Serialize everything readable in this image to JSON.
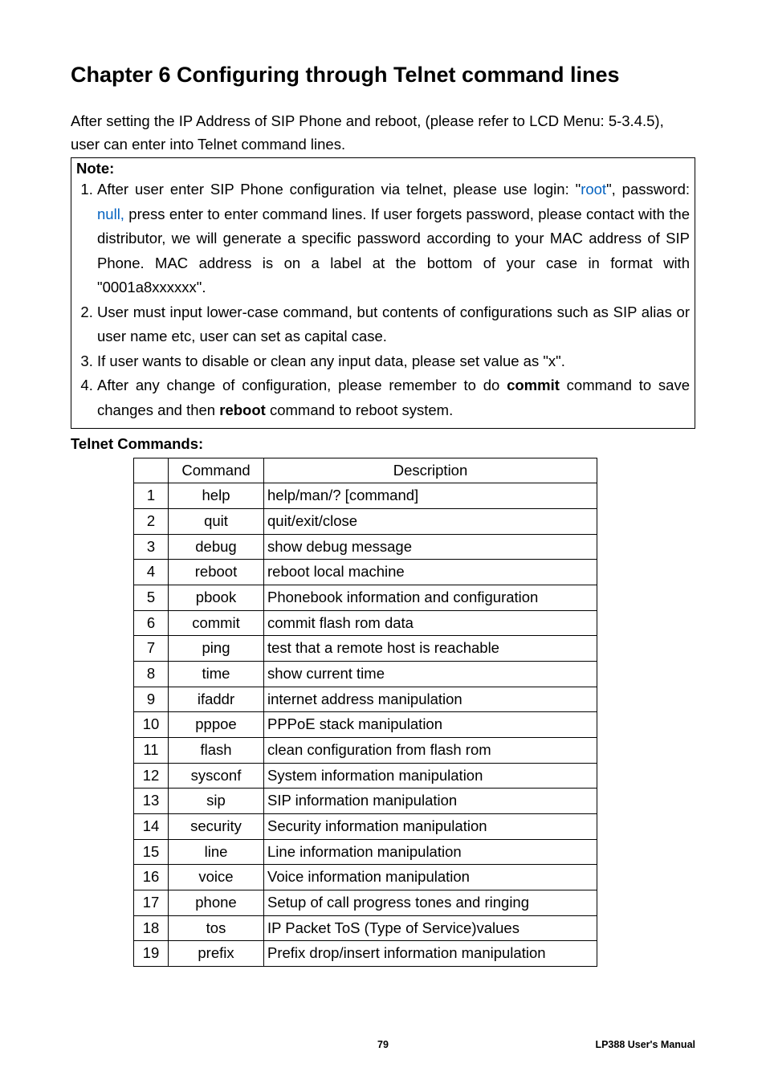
{
  "chapterTitle": "Chapter 6 Configuring through Telnet command lines",
  "intro": "After setting the IP Address of SIP Phone and reboot, (please refer to LCD Menu: 5-3.4.5), user can enter into Telnet command lines.",
  "noteLabel": "Note:",
  "notes": {
    "n1a": "After user enter SIP Phone configuration via telnet, please use login: \"",
    "n1root": "root",
    "n1b": "\", password: ",
    "n1null": "null,",
    "n1c": " press enter to enter command lines. If user forgets password, please contact with the distributor, we will generate a specific password according to your MAC address of SIP Phone. MAC address is on a label at the bottom of your case in format with \"0001a8xxxxxx\".",
    "n2": "User must input lower-case command, but contents of configurations such as SIP alias or user name etc, user can set as capital case.",
    "n3": "If user wants to disable or clean any input data, please set value as \"x\".",
    "n4a": "After any change of configuration, please remember to do ",
    "n4commit": "commit",
    "n4b": " command to save changes and then ",
    "n4reboot": "reboot",
    "n4c": " command to reboot system."
  },
  "telnetHeading": "Telnet Commands:",
  "tableHeaders": {
    "blank": "",
    "command": "Command",
    "description": "Description"
  },
  "rows": [
    {
      "idx": "1",
      "cmd": "help",
      "desc": "help/man/? [command]"
    },
    {
      "idx": "2",
      "cmd": "quit",
      "desc": "quit/exit/close"
    },
    {
      "idx": "3",
      "cmd": "debug",
      "desc": "show debug message"
    },
    {
      "idx": "4",
      "cmd": "reboot",
      "desc": "reboot local machine"
    },
    {
      "idx": "5",
      "cmd": "pbook",
      "desc": "Phonebook information and configuration"
    },
    {
      "idx": "6",
      "cmd": "commit",
      "desc": "commit flash rom data"
    },
    {
      "idx": "7",
      "cmd": "ping",
      "desc": "test that a remote host is reachable"
    },
    {
      "idx": "8",
      "cmd": "time",
      "desc": "show current time"
    },
    {
      "idx": "9",
      "cmd": "ifaddr",
      "desc": "internet address manipulation"
    },
    {
      "idx": "10",
      "cmd": "pppoe",
      "desc": "PPPoE stack manipulation"
    },
    {
      "idx": "11",
      "cmd": "flash",
      "desc": "clean configuration from flash rom"
    },
    {
      "idx": "12",
      "cmd": "sysconf",
      "desc": "System information manipulation"
    },
    {
      "idx": "13",
      "cmd": "sip",
      "desc": "SIP information manipulation"
    },
    {
      "idx": "14",
      "cmd": "security",
      "desc": "Security information manipulation"
    },
    {
      "idx": "15",
      "cmd": "line",
      "desc": "Line information manipulation"
    },
    {
      "idx": "16",
      "cmd": "voice",
      "desc": "Voice information manipulation"
    },
    {
      "idx": "17",
      "cmd": "phone",
      "desc": "Setup of call progress tones and ringing"
    },
    {
      "idx": "18",
      "cmd": "tos",
      "desc": "IP Packet ToS (Type of Service)values"
    },
    {
      "idx": "19",
      "cmd": "prefix",
      "desc": "Prefix drop/insert information manipulation"
    }
  ],
  "footer": {
    "page": "79",
    "manual": "LP388  User's  Manual"
  }
}
